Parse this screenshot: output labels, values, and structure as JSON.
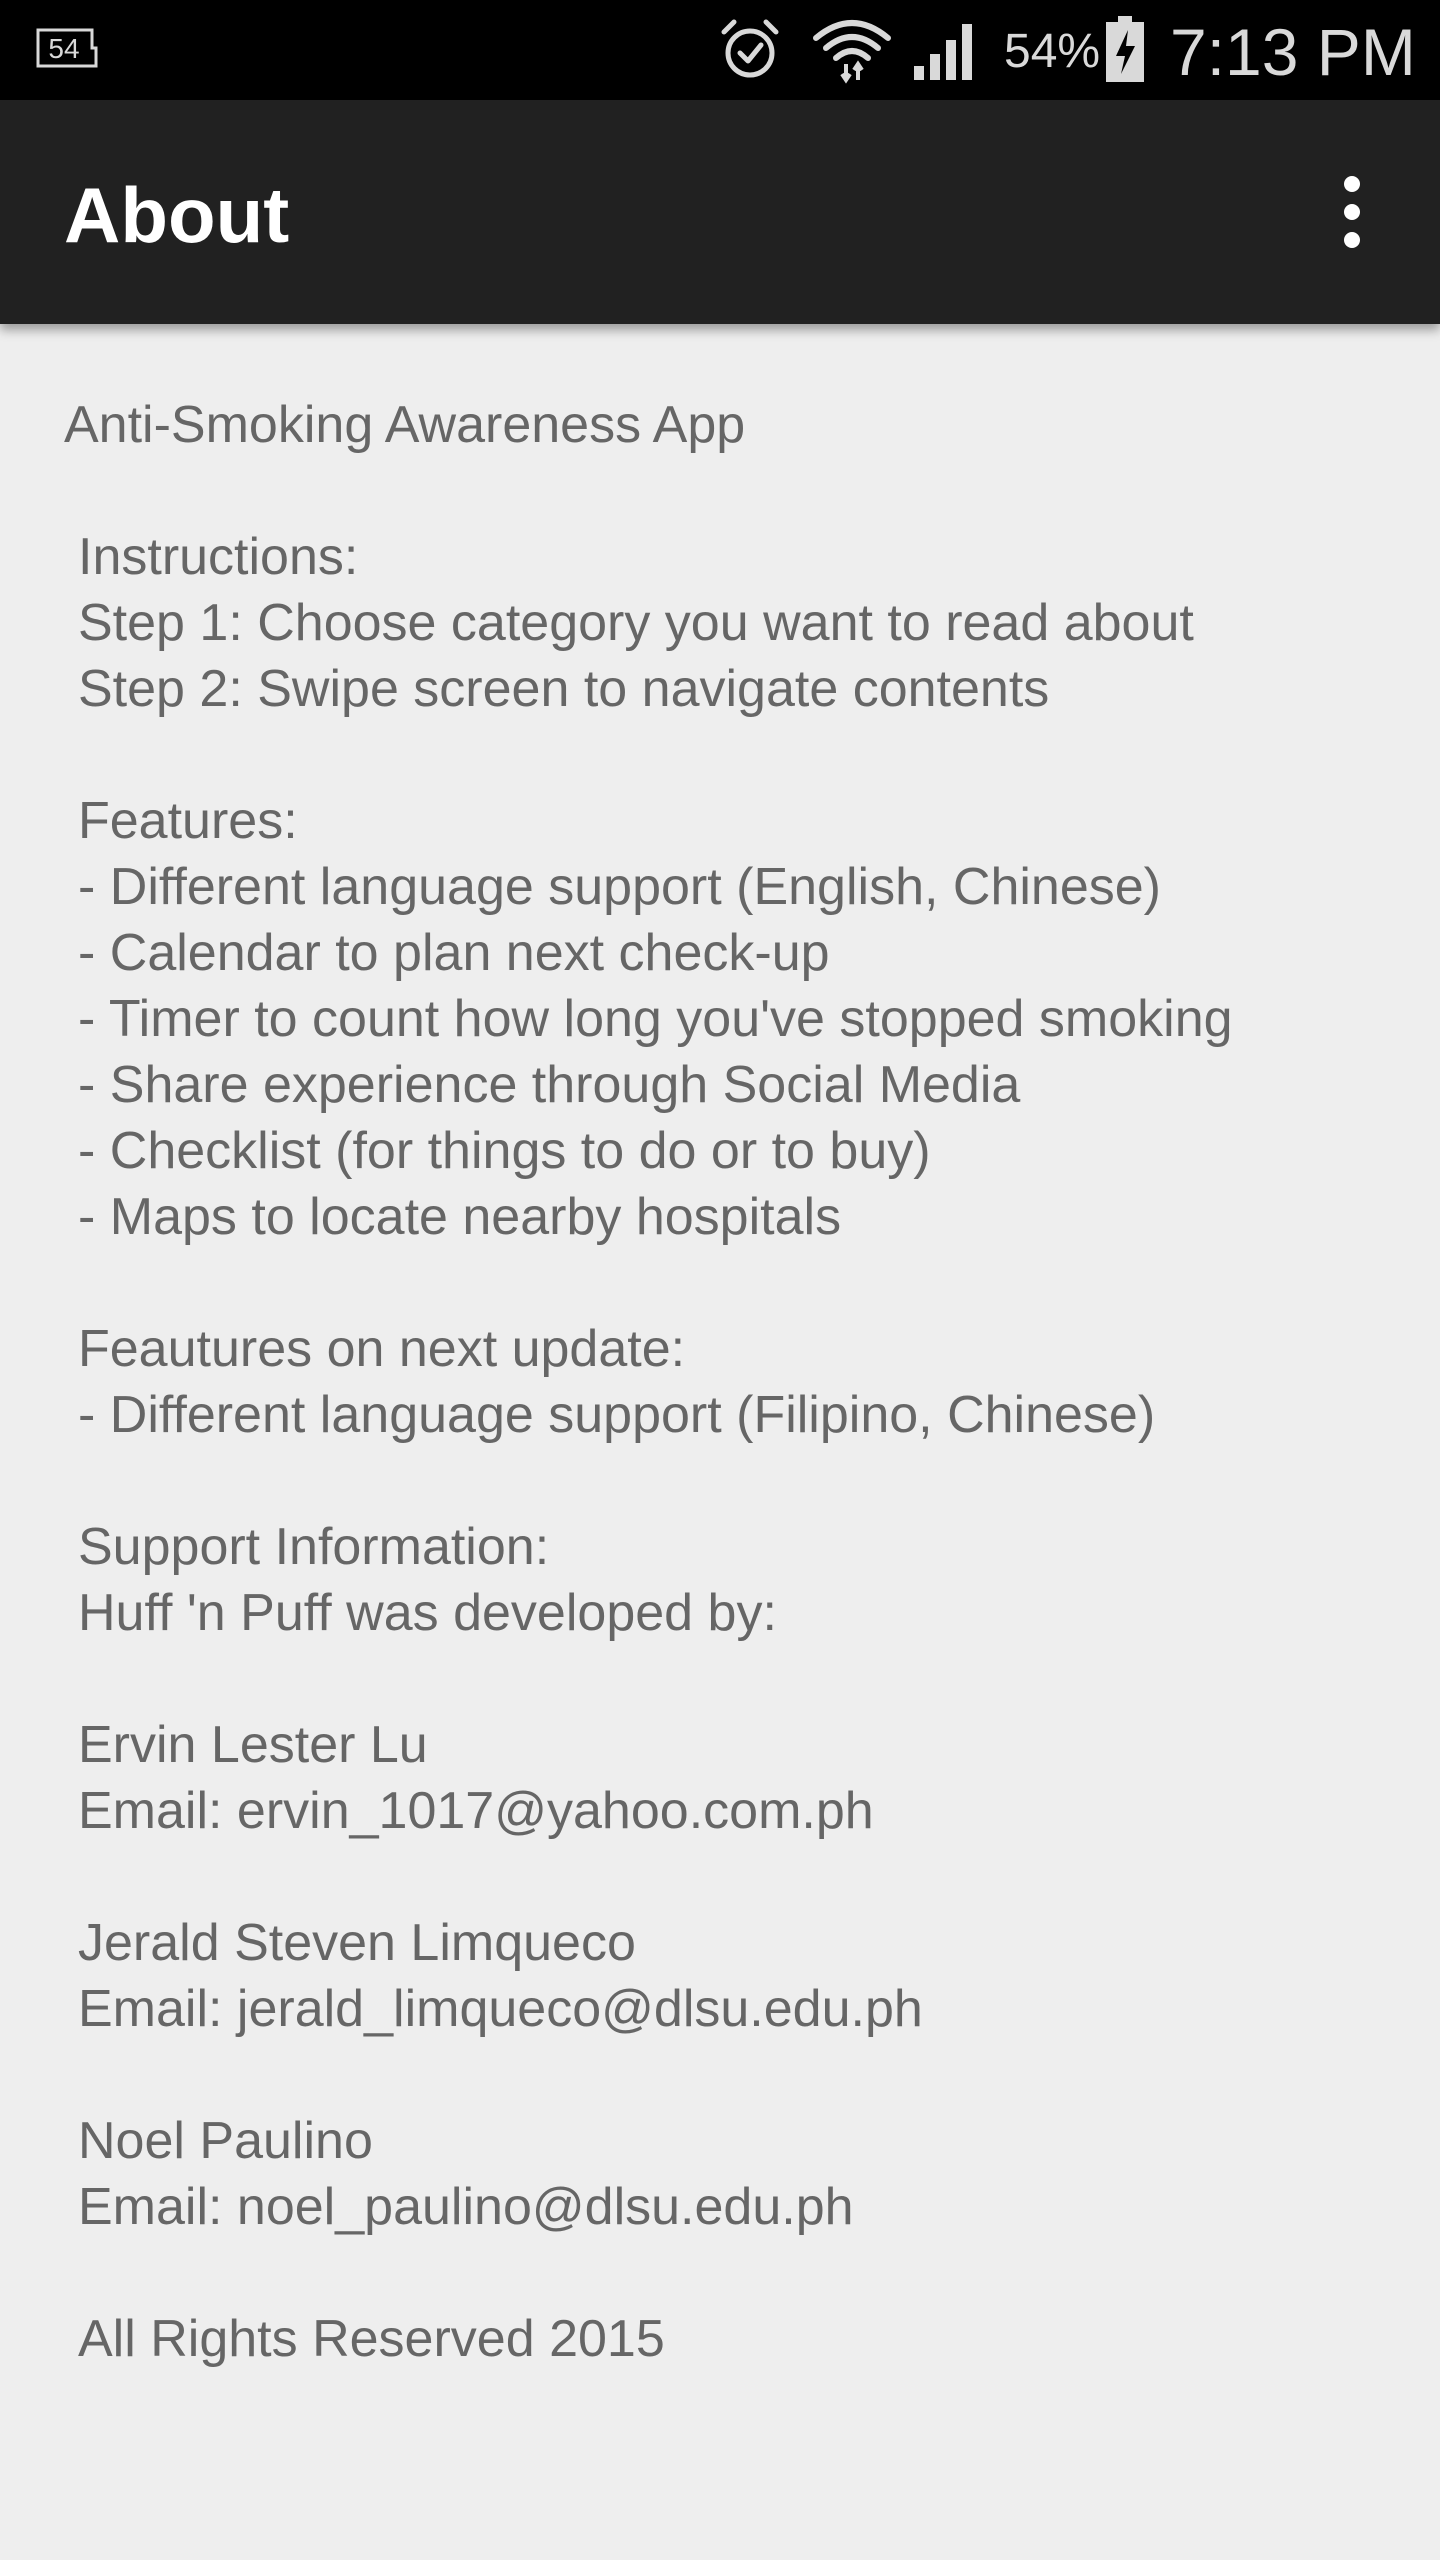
{
  "status_bar": {
    "notification_badge": "54",
    "battery_percent": "54%",
    "time": "7:13 PM",
    "icons": [
      "notification-badge-icon",
      "alarm-icon",
      "wifi-icon",
      "cell-signal-icon",
      "battery-charging-icon"
    ]
  },
  "app_bar": {
    "title": "About",
    "overflow_icon": "more-vert-icon"
  },
  "content": {
    "app_name": "Anti-Smoking Awareness App",
    "instructions": {
      "heading": "Instructions:",
      "steps": [
        "Step 1: Choose category you want to read about",
        "Step 2: Swipe screen to navigate contents"
      ]
    },
    "features": {
      "heading": "Features:",
      "items": [
        "- Different language support (English, Chinese)",
        "- Calendar to plan next check-up",
        "- Timer to count how long you've stopped smoking",
        "- Share experience through Social Media",
        "- Checklist (for things to do or to buy)",
        "- Maps to locate nearby hospitals"
      ]
    },
    "next_update": {
      "heading": "Feautures on next update:",
      "items": [
        "- Different language support (Filipino, Chinese)"
      ]
    },
    "support": {
      "heading": "Support Information:",
      "subheading": "Huff 'n Puff was developed by:"
    },
    "developers": [
      {
        "name": "Ervin Lester Lu",
        "email": "Email: ervin_1017@yahoo.com.ph"
      },
      {
        "name": "Jerald Steven Limqueco",
        "email": "Email: jerald_limqueco@dlsu.edu.ph"
      },
      {
        "name": "Noel Paulino",
        "email": "Email: noel_paulino@dlsu.edu.ph"
      }
    ],
    "footer": "All Rights Reserved 2015"
  },
  "colors": {
    "status_bar_bg": "#000000",
    "app_bar_bg": "#212121",
    "page_bg": "#eeeeee",
    "body_text": "#666666",
    "title_text": "#ffffff"
  }
}
